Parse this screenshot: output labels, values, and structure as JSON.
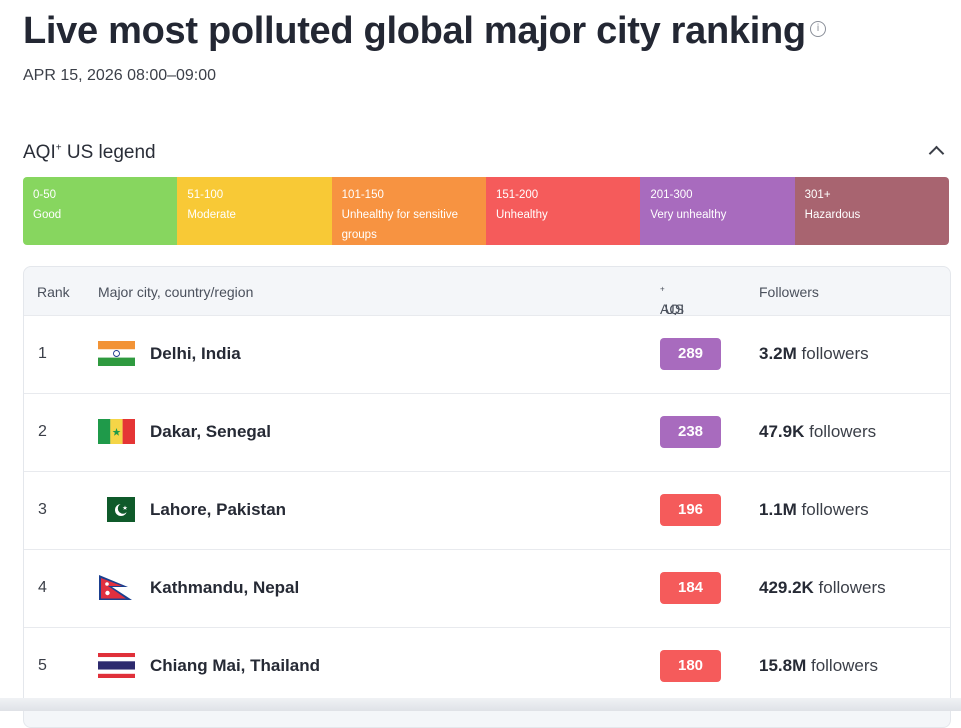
{
  "header": {
    "title": "Live most polluted global major city ranking",
    "info_icon": "info-circle-icon",
    "timestamp": "APR 15, 2026 08:00–09:00"
  },
  "legend": {
    "title_prefix": "AQI",
    "title_sup": "+",
    "title_suffix": " US legend",
    "toggle_icon": "chevron-up-icon",
    "levels": [
      {
        "range": "0-50",
        "label": "Good",
        "color": "#87d65f"
      },
      {
        "range": "51-100",
        "label": "Moderate",
        "color": "#f8c936"
      },
      {
        "range": "101-150",
        "label": "Unhealthy for sensitive groups",
        "color": "#f79341"
      },
      {
        "range": "151-200",
        "label": "Unhealthy",
        "color": "#f55b5b"
      },
      {
        "range": "201-300",
        "label": "Very unhealthy",
        "color": "#a86bbe"
      },
      {
        "range": "301+",
        "label": "Hazardous",
        "color": "#a86470"
      }
    ]
  },
  "table": {
    "headers": {
      "rank": "Rank",
      "city": "Major city, country/region",
      "aqi_prefix": "AQI",
      "aqi_sup": "+",
      "aqi_suffix": " US",
      "followers": "Followers"
    },
    "rows": [
      {
        "rank": "1",
        "city": "Delhi, India",
        "flag": "india-flag-icon",
        "aqi": "289",
        "aqi_color": "#a86bbe",
        "followers_count": "3.2M",
        "followers_label": " followers"
      },
      {
        "rank": "2",
        "city": "Dakar, Senegal",
        "flag": "senegal-flag-icon",
        "aqi": "238",
        "aqi_color": "#a86bbe",
        "followers_count": "47.9K",
        "followers_label": " followers"
      },
      {
        "rank": "3",
        "city": "Lahore, Pakistan",
        "flag": "pakistan-flag-icon",
        "aqi": "196",
        "aqi_color": "#f55b5b",
        "followers_count": "1.1M",
        "followers_label": " followers"
      },
      {
        "rank": "4",
        "city": "Kathmandu, Nepal",
        "flag": "nepal-flag-icon",
        "aqi": "184",
        "aqi_color": "#f55b5b",
        "followers_count": "429.2K",
        "followers_label": " followers"
      },
      {
        "rank": "5",
        "city": "Chiang Mai, Thailand",
        "flag": "thailand-flag-icon",
        "aqi": "180",
        "aqi_color": "#f55b5b",
        "followers_count": "15.8M",
        "followers_label": " followers"
      }
    ]
  }
}
